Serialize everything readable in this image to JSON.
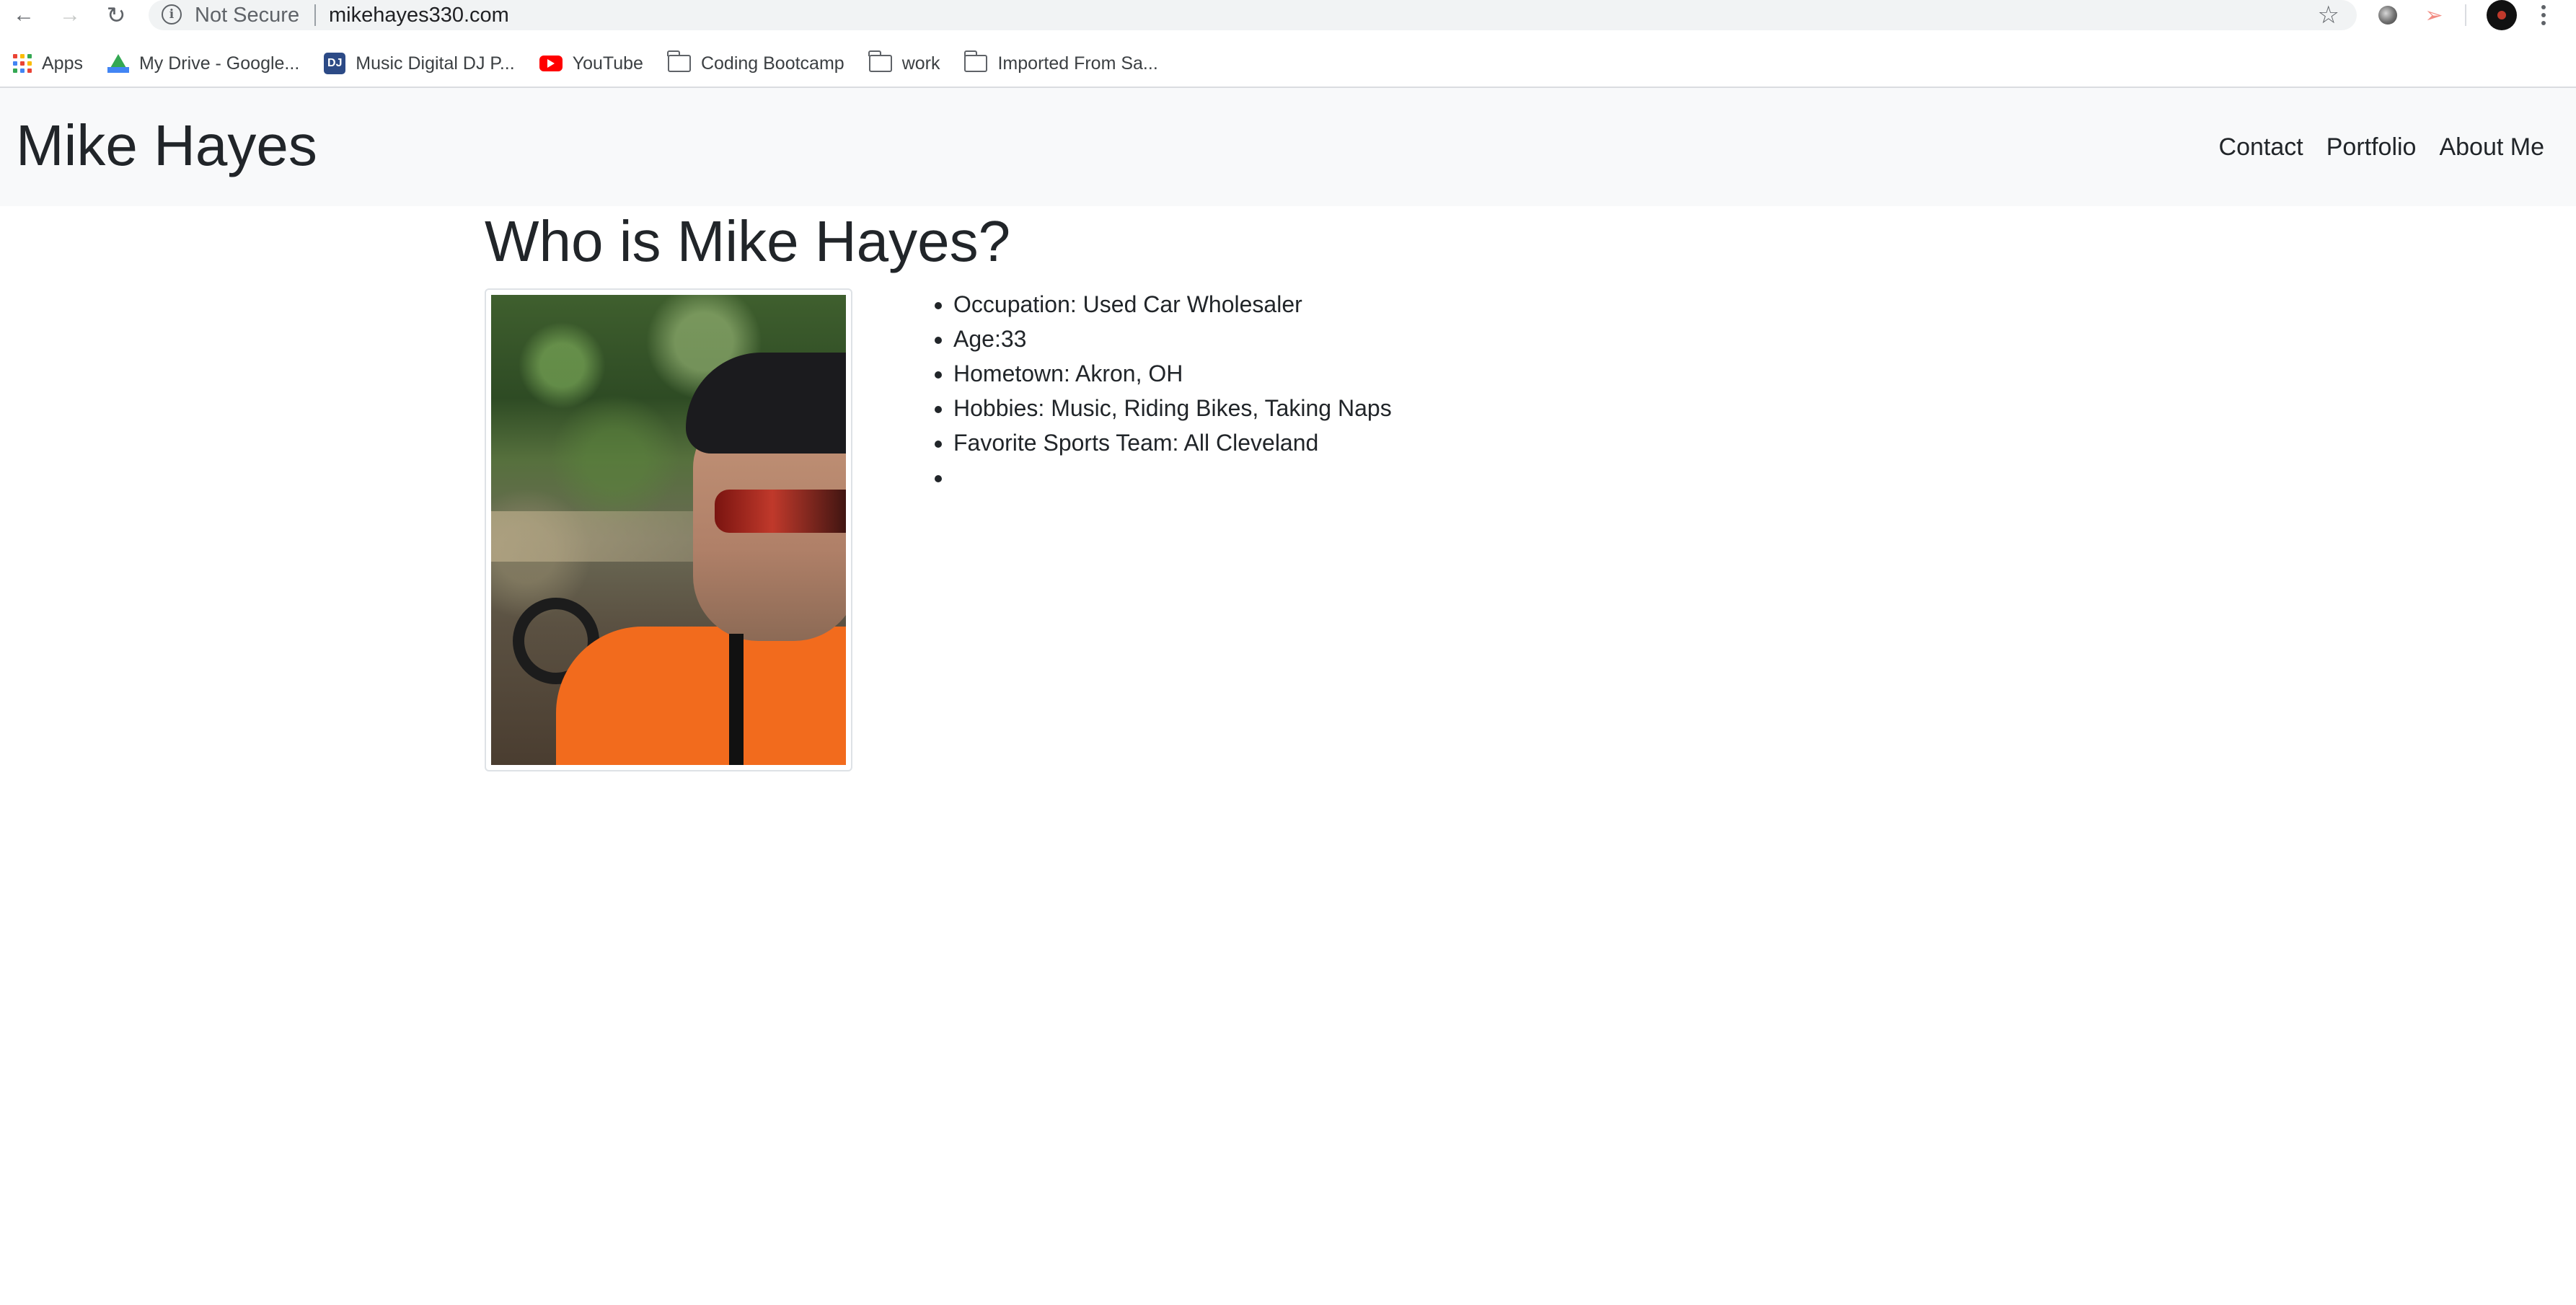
{
  "browser": {
    "omnibox": {
      "security_label": "Not Secure",
      "url": "mikehayes330.com"
    },
    "bookmarks": [
      {
        "label": "Apps",
        "icon": "apps-grid-icon"
      },
      {
        "label": "My Drive - Google...",
        "icon": "google-drive-icon"
      },
      {
        "label": "Music Digital DJ P...",
        "icon": "dj-icon"
      },
      {
        "label": "YouTube",
        "icon": "youtube-icon"
      },
      {
        "label": "Coding Bootcamp",
        "icon": "folder-icon"
      },
      {
        "label": "work",
        "icon": "folder-icon"
      },
      {
        "label": "Imported From Sa...",
        "icon": "folder-icon"
      }
    ]
  },
  "site": {
    "brand": "Mike Hayes",
    "nav": [
      {
        "label": "Contact"
      },
      {
        "label": "Portfolio"
      },
      {
        "label": "About Me"
      }
    ]
  },
  "main": {
    "heading": "Who is Mike Hayes?",
    "photo_alt": "Selfie with mountain bike in the woods",
    "details": [
      "Occupation: Used Car Wholesaler",
      "Age:33",
      "Hometown: Akron, OH",
      "Hobbies: Music, Riding Bikes, Taking Naps",
      "Favorite Sports Team: All Cleveland",
      ""
    ]
  },
  "colors": {
    "navbar_bg": "#f8f9fa",
    "text": "#212529",
    "shirt_orange": "#f26b1d",
    "youtube_red": "#ff0000"
  }
}
